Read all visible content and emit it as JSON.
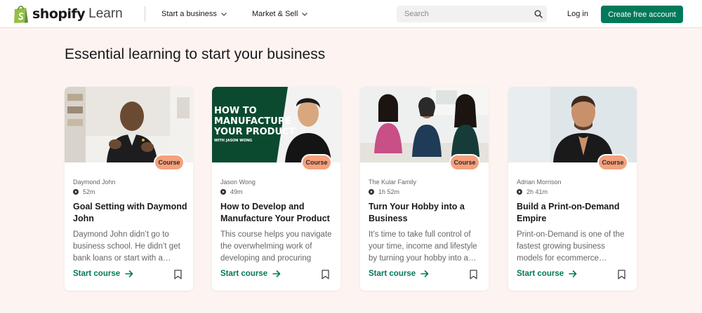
{
  "header": {
    "logo_word": "shopify",
    "logo_sub": "Learn",
    "nav": [
      {
        "label": "Start a business"
      },
      {
        "label": "Market & Sell"
      }
    ],
    "search_placeholder": "Search",
    "login_label": "Log in",
    "cta_label": "Create free account"
  },
  "colors": {
    "brand_green": "#007a5a",
    "badge_orange": "#f5a07d",
    "page_bg": "#fdf3f0"
  },
  "main": {
    "title": "Essential learning to start your business",
    "cards": [
      {
        "badge": "Course",
        "author": "Daymond John",
        "duration": "52m",
        "title": "Goal Setting with Daymond John",
        "description": "Daymond John didn’t go to business school. He didn’t get bank loans or start with a…",
        "start_label": "Start course"
      },
      {
        "badge": "Course",
        "author": "Jason Wong",
        "duration": "49m",
        "title": "How to Develop and Manufacture Your Product",
        "description": "This course helps you navigate the overwhelming work of developing and procuring you…",
        "start_label": "Start course",
        "image_text": [
          "HOW TO",
          "MANUFACTURE",
          "YOUR PRODUCT",
          "WITH JASON WONG"
        ]
      },
      {
        "badge": "Course",
        "author": "The Kular Family",
        "duration": "1h 52m",
        "title": "Turn Your Hobby into a Business",
        "description": "It’s time to take full control of your time, income and lifestyle by turning your hobby into a…",
        "start_label": "Start course"
      },
      {
        "badge": "Course",
        "author": "Adrian Morrison",
        "duration": "2h 41m",
        "title": "Build a Print-on-Demand Empire",
        "description": "Print-on-Demand is one of the fastest growing business models for ecommerce…",
        "start_label": "Start course"
      }
    ]
  }
}
